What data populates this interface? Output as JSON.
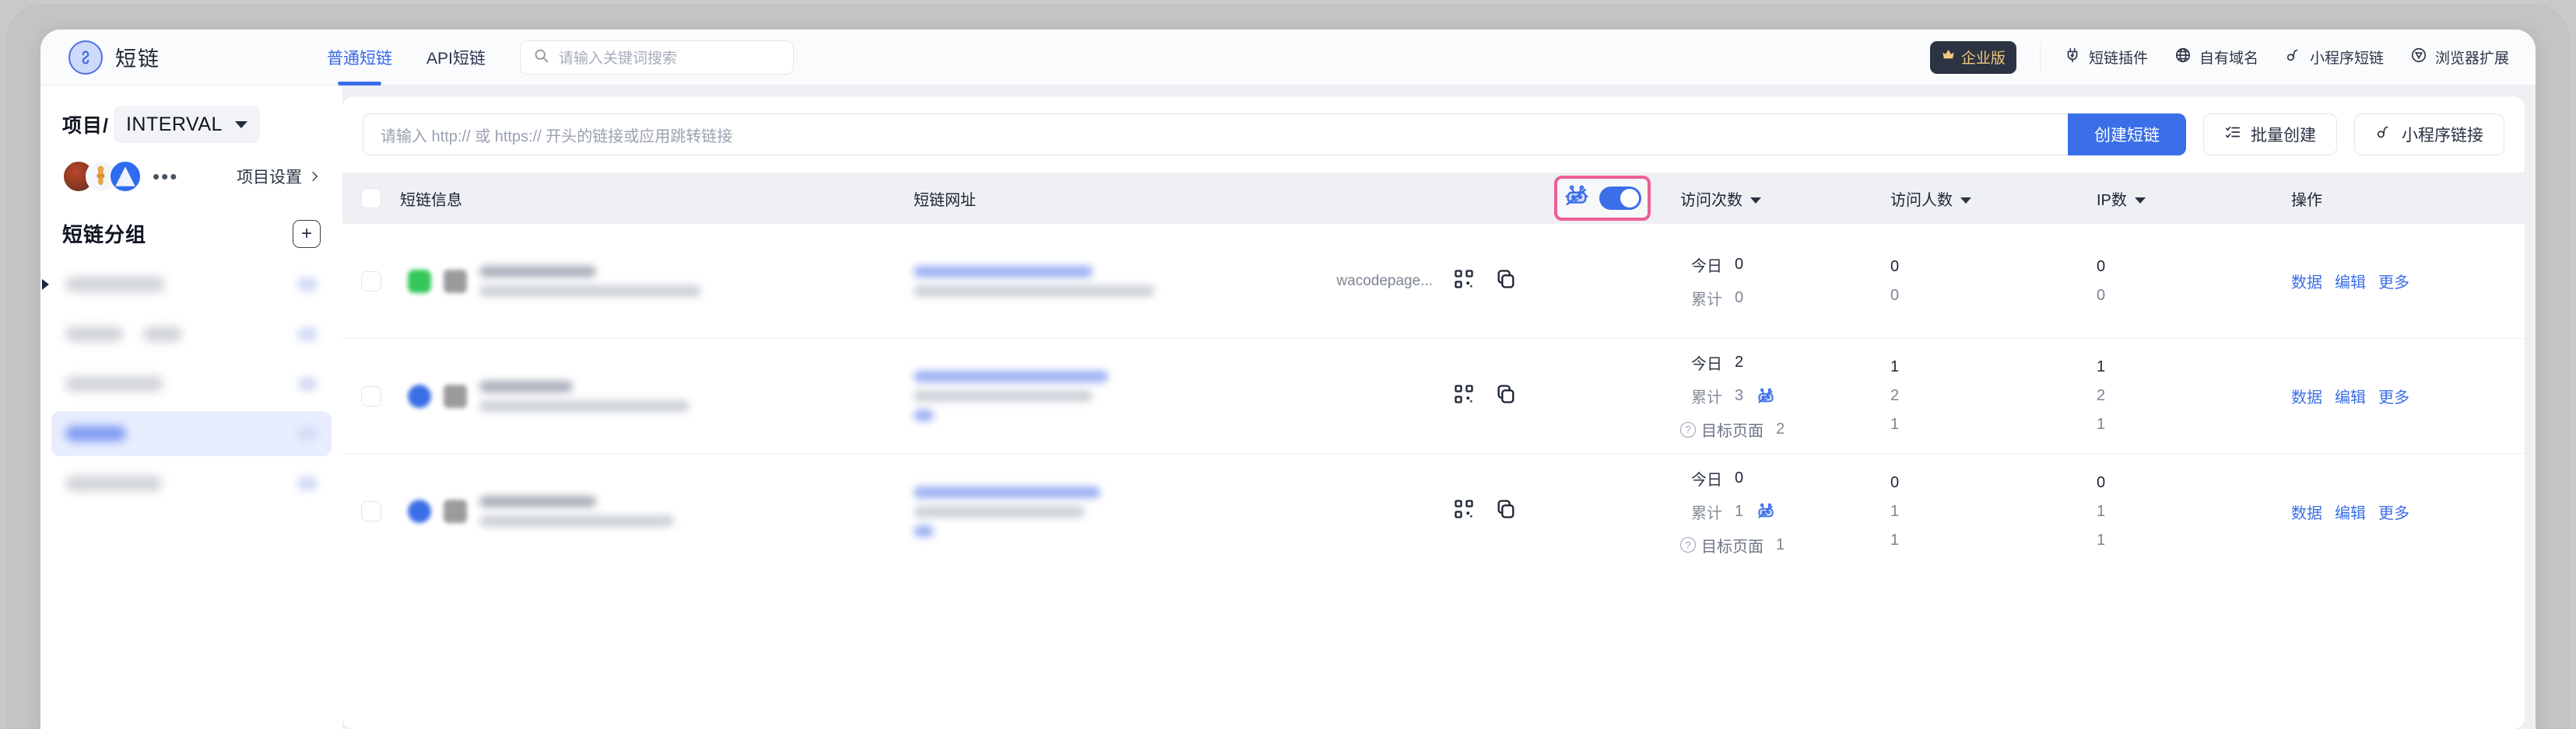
{
  "app": {
    "logo_icon": "link-circle-icon",
    "name": "短链"
  },
  "topbar": {
    "tabs": [
      {
        "label": "普通短链",
        "active": true
      },
      {
        "label": "API短链",
        "active": false
      }
    ],
    "search": {
      "icon": "search-icon",
      "placeholder": "请输入关键词搜索",
      "value": ""
    },
    "enterprise_badge": {
      "icon": "crown-icon",
      "label": "企业版"
    },
    "right_items": [
      {
        "icon": "plug-icon",
        "label": "短链插件"
      },
      {
        "icon": "globe-icon",
        "label": "自有域名"
      },
      {
        "icon": "miniprogram-icon",
        "label": "小程序短链"
      },
      {
        "icon": "browser-extension-icon",
        "label": "浏览器扩展"
      }
    ]
  },
  "sidebar": {
    "project_label": "项目/",
    "project_name": "INTERVAL",
    "project_caret_icon": "chevron-down-icon",
    "members_more_icon": "ellipsis-icon",
    "project_settings": {
      "label": "项目设置",
      "icon": "chevron-right-icon"
    },
    "group_title": "短链分组",
    "add_group_icon": "plus-icon",
    "groups": [
      {
        "label": "",
        "redacted": true,
        "selected": false,
        "expandable": true
      },
      {
        "label": "",
        "redacted": true,
        "selected": false,
        "expandable": false
      },
      {
        "label": "",
        "redacted": true,
        "selected": false,
        "expandable": false
      },
      {
        "label": "",
        "redacted": true,
        "selected": true,
        "expandable": false
      },
      {
        "label": "",
        "redacted": true,
        "selected": false,
        "expandable": false
      }
    ]
  },
  "create_bar": {
    "url_placeholder": "请输入 http:// 或 https:// 开头的链接或应用跳转链接",
    "url_value": "",
    "primary_button": "创建短链",
    "batch_button": {
      "icon": "list-check-icon",
      "label": "批量创建"
    },
    "miniprogram_button": {
      "icon": "miniprogram-icon",
      "label": "小程序链接"
    }
  },
  "table": {
    "headers": {
      "checkbox": "",
      "info": "短链信息",
      "url": "短链网址",
      "bot_filter": {
        "icon": "robot-off-icon",
        "toggle_on": true,
        "highlighted": true,
        "highlight_color": "#ec5f93"
      },
      "pv": "访问次数",
      "uv": "访问人数",
      "ip": "IP数",
      "actions": "操作"
    },
    "sort_icon": "caret-down-icon",
    "row_labels": {
      "today": "今日",
      "total": "累计",
      "target": "目标页面"
    },
    "target_help_icon": "question-circle-icon",
    "robot_icon": "robot-icon",
    "qr_icon": "qrcode-icon",
    "copy_icon": "copy-icon",
    "actions": [
      "数据",
      "编辑",
      "更多"
    ],
    "rows": [
      {
        "info_redacted": true,
        "url_redacted": true,
        "url_tail": "wacodepage...",
        "has_target_row": false,
        "has_robot_badge": false,
        "today": {
          "pv": "0",
          "uv": "0",
          "ip": "0"
        },
        "total": {
          "pv": "0",
          "uv": "0",
          "ip": "0"
        },
        "target": {
          "pv": "",
          "uv": "",
          "ip": ""
        }
      },
      {
        "info_redacted": true,
        "url_redacted": true,
        "url_tail": "",
        "has_target_row": true,
        "has_robot_badge": true,
        "today": {
          "pv": "2",
          "uv": "1",
          "ip": "1"
        },
        "total": {
          "pv": "3",
          "uv": "2",
          "ip": "2"
        },
        "target": {
          "pv": "2",
          "uv": "1",
          "ip": "1"
        }
      },
      {
        "info_redacted": true,
        "url_redacted": true,
        "url_tail": "",
        "has_target_row": true,
        "has_robot_badge": true,
        "today": {
          "pv": "0",
          "uv": "0",
          "ip": "0"
        },
        "total": {
          "pv": "1",
          "uv": "1",
          "ip": "1"
        },
        "target": {
          "pv": "1",
          "uv": "1",
          "ip": "1"
        }
      }
    ]
  },
  "colors": {
    "accent": "#3b6fe8",
    "highlight": "#ec5f93",
    "badge_gold": "#f2c97b",
    "badge_bg": "#2c3342",
    "page_bg": "#eef0f4"
  }
}
